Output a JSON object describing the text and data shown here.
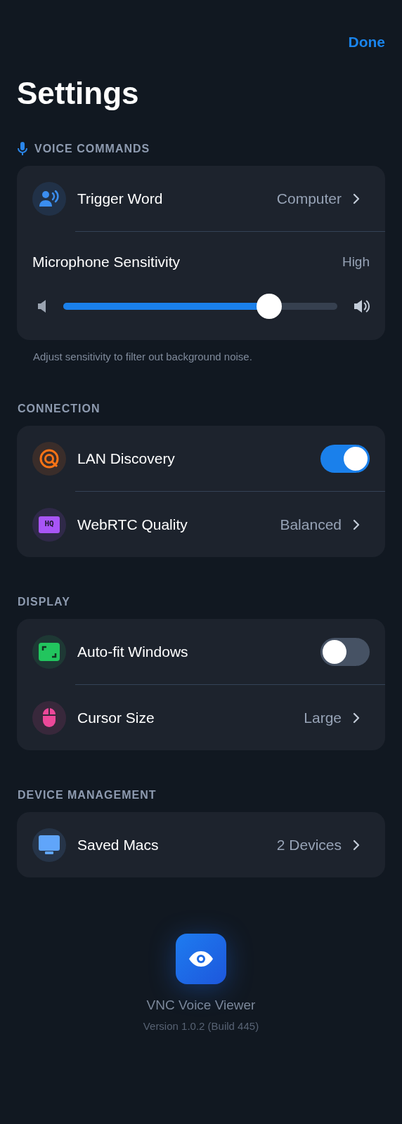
{
  "header": {
    "done": "Done",
    "title": "Settings"
  },
  "sections": [
    {
      "title": "VOICE COMMANDS",
      "title_icon": true,
      "rows": [
        {
          "kind": "link",
          "label": "Trigger Word",
          "value": "Computer",
          "color": "#3b8ef0"
        },
        {
          "kind": "slider",
          "label": "Microphone Sensitivity",
          "reading": "High",
          "level": 0.75
        }
      ],
      "footnote": "Adjust sensitivity to filter out background noise."
    },
    {
      "title": "CONNECTION",
      "rows": [
        {
          "kind": "toggle",
          "label": "LAN Discovery",
          "on": true,
          "color": "#f97316"
        },
        {
          "kind": "link",
          "label": "WebRTC Quality",
          "value": "Balanced",
          "color": "#a855f7",
          "icon_text": "HQ"
        }
      ]
    },
    {
      "title": "DISPLAY",
      "rows": [
        {
          "kind": "toggle",
          "label": "Auto-fit Windows",
          "on": false,
          "color": "#22c55e"
        },
        {
          "kind": "link",
          "label": "Cursor Size",
          "value": "Large",
          "color": "#ec4899"
        }
      ]
    },
    {
      "title": "DEVICE MANAGEMENT",
      "rows": [
        {
          "kind": "link",
          "label": "Saved Macs",
          "value": "2 Devices",
          "color": "#60a5fa"
        }
      ]
    }
  ],
  "app": {
    "name": "VNC Voice Viewer",
    "version": "Version 1.0.2 (Build 445)"
  }
}
